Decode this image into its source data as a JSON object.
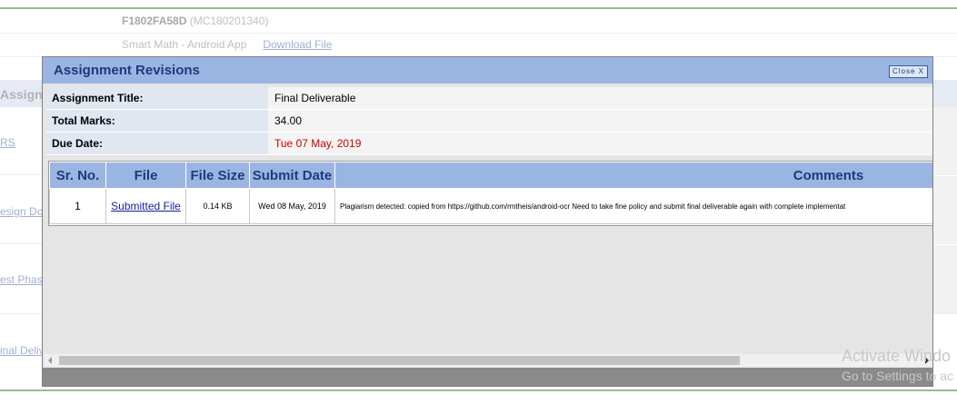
{
  "background": {
    "code": "F1802FA58D",
    "code_suffix": "(MC180201340)",
    "project": "Smart Math - Android App",
    "download_label": "Download File",
    "section_header": "Assignm",
    "links": [
      "RS",
      "esign Doc",
      "est Phase",
      "inal Deliv"
    ]
  },
  "modal": {
    "title": "Assignment Revisions",
    "close_label": "Close X",
    "info": [
      {
        "label": "Assignment Title:",
        "value": "Final Deliverable"
      },
      {
        "label": "Total Marks:",
        "value": "34.00"
      },
      {
        "label": "Due Date:",
        "value": "Tue 07 May, 2019"
      }
    ],
    "table": {
      "headers": [
        "Sr. No.",
        "File",
        "File Size",
        "Submit Date",
        "Comments"
      ],
      "rows": [
        {
          "sr": "1",
          "file": "Submitted File",
          "size": "0.14 KB",
          "date": "Wed 08 May, 2019",
          "comment": "Plagiarism detected: copied from https://github.com/rmtheis/android-ocr Need to take fine policy and submit final deliverable again with complete implementat"
        }
      ]
    }
  },
  "watermark": {
    "line1": "Activate Windo",
    "line2": "Go to Settings to ac"
  },
  "colors": {
    "accent": "#9bb5e3",
    "title_text": "#1f3a7a",
    "due_date": "#cc0000"
  }
}
